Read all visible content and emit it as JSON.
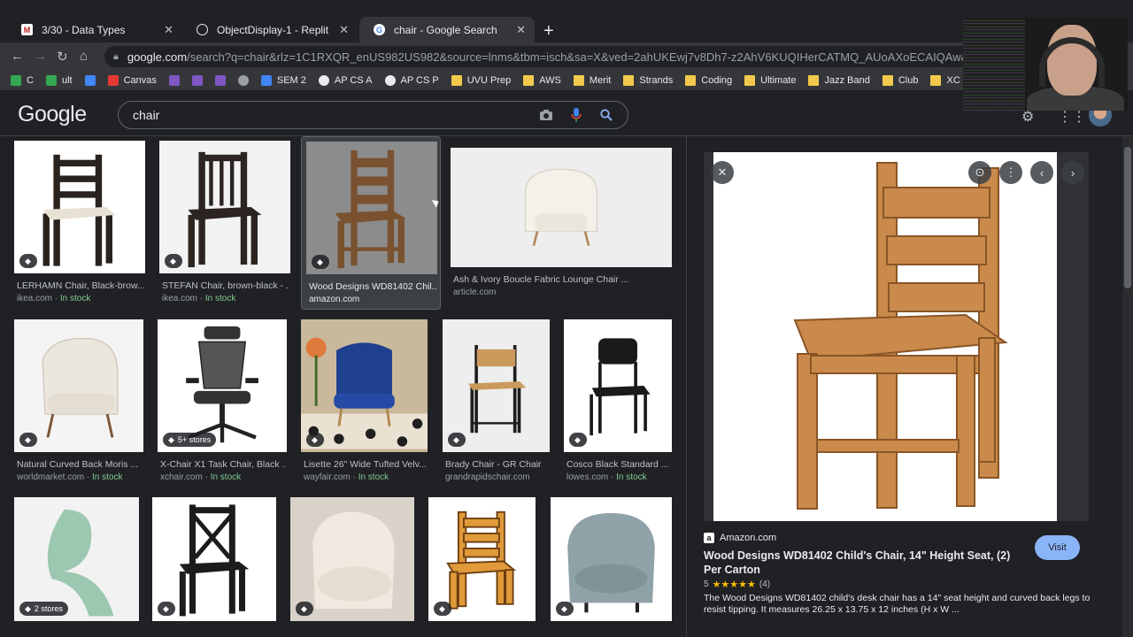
{
  "browser": {
    "tabs": [
      {
        "title": "3/30 - Data Types",
        "icon": "gmail-icon"
      },
      {
        "title": "ObjectDisplay-1 - Replit",
        "icon": "replit-icon"
      },
      {
        "title": "chair - Google Search",
        "icon": "google-icon"
      }
    ],
    "url_host": "google.com",
    "url_rest": "/search?q=chair&rlz=1C1RXQR_enUS982US982&source=lnms&tbm=isch&sa=X&ved=2ahUKEwj7v8Dh7-z2AhV6KUQIHerCATMQ_AUoAXoECAIQAw&cshid=164861038835",
    "bookmarks": [
      {
        "label": "C",
        "kind": "drive"
      },
      {
        "label": "ult",
        "kind": "drive"
      },
      {
        "label": "",
        "kind": "calendar"
      },
      {
        "label": "Canvas",
        "kind": "canvas"
      },
      {
        "label": "",
        "kind": "app"
      },
      {
        "label": "",
        "kind": "app"
      },
      {
        "label": "",
        "kind": "app"
      },
      {
        "label": "",
        "kind": "check"
      },
      {
        "label": "SEM 2",
        "kind": "doc"
      },
      {
        "label": "AP CS A",
        "kind": "github"
      },
      {
        "label": "AP CS P",
        "kind": "github"
      },
      {
        "label": "UVU Prep",
        "kind": "folder"
      },
      {
        "label": "AWS",
        "kind": "folder"
      },
      {
        "label": "Merit",
        "kind": "folder"
      },
      {
        "label": "Strands",
        "kind": "folder"
      },
      {
        "label": "Coding",
        "kind": "folder"
      },
      {
        "label": "Ultimate",
        "kind": "folder"
      },
      {
        "label": "Jazz Band",
        "kind": "folder"
      },
      {
        "label": "Club",
        "kind": "folder"
      },
      {
        "label": "XC",
        "kind": "folder"
      }
    ]
  },
  "google": {
    "logo": "Google",
    "query": "chair"
  },
  "results": [
    {
      "title": "LERHAMN Chair, Black-brow...",
      "source": "ikea.com",
      "stock": "In stock",
      "tag": "",
      "bg": "#ffffff",
      "chair": "dark-cushion"
    },
    {
      "title": "STEFAN Chair, brown-black - ...",
      "source": "ikea.com",
      "stock": "In stock",
      "tag": "",
      "bg": "#f2f2f2",
      "chair": "dark"
    },
    {
      "title": "Wood Designs WD81402 Chil...",
      "source": "amazon.com",
      "stock": "",
      "tag": "",
      "bg": "#8c8c8c",
      "chair": "wood"
    },
    {
      "title": "Ash & Ivory Boucle Fabric Lounge Chair ...",
      "source": "article.com",
      "stock": "",
      "tag": "",
      "bg": "#eeeeee",
      "chair": "lounge"
    },
    {
      "title": "Natural Curved Back Moris ...",
      "source": "worldmarket.com",
      "stock": "In stock",
      "tag": "",
      "bg": "#f4f4f4",
      "chair": "armchair"
    },
    {
      "title": "X-Chair X1 Task Chair, Black ...",
      "source": "xchair.com",
      "stock": "In stock",
      "tag": "5+ stores",
      "bg": "#ffffff",
      "chair": "office"
    },
    {
      "title": "Lisette 26\" Wide Tufted Velv...",
      "source": "wayfair.com",
      "stock": "In stock",
      "tag": "",
      "bg": "#c9b89a",
      "chair": "velvet"
    },
    {
      "title": "Brady Chair - GR Chair",
      "source": "grandrapidschair.com",
      "stock": "",
      "tag": "",
      "bg": "#eeeeee",
      "chair": "brady"
    },
    {
      "title": "Cosco Black Standard ...",
      "source": "lowes.com",
      "stock": "In stock",
      "tag": "",
      "bg": "#ffffff",
      "chair": "folding"
    },
    {
      "title": "",
      "source": "",
      "stock": "",
      "tag": "2 stores",
      "bg": "#f2f2f2",
      "chair": "panton"
    },
    {
      "title": "",
      "source": "",
      "stock": "",
      "tag": "",
      "bg": "#ffffff",
      "chair": "xback"
    },
    {
      "title": "",
      "source": "",
      "stock": "",
      "tag": "",
      "bg": "#d8d2c8",
      "chair": "boucle"
    },
    {
      "title": "",
      "source": "",
      "stock": "",
      "tag": "",
      "bg": "#ffffff",
      "chair": "cartoon"
    },
    {
      "title": "",
      "source": "",
      "stock": "",
      "tag": "",
      "bg": "#ffffff",
      "chair": "tub"
    }
  ],
  "preview": {
    "source": "Amazon.com",
    "title": "Wood Designs WD81402 Child's Chair, 14\" Height Seat, (2) Per Carton",
    "rating": "5",
    "stars": "★★★★★",
    "reviews": "(4)",
    "description": "The Wood Designs WD81402 child's desk chair has a 14\" seat height and curved back legs to resist tipping. It measures 26.25 x 13.75 x 12 inches (H x W ...",
    "visit_label": "Visit",
    "close_glyph": "✕",
    "lens_glyph": "⊙",
    "more_glyph": "⋮",
    "prev_glyph": "‹",
    "next_glyph": "›"
  },
  "colors": {
    "accent": "#8ab4f8",
    "stock": "#81c995",
    "star": "#fbbc04"
  }
}
